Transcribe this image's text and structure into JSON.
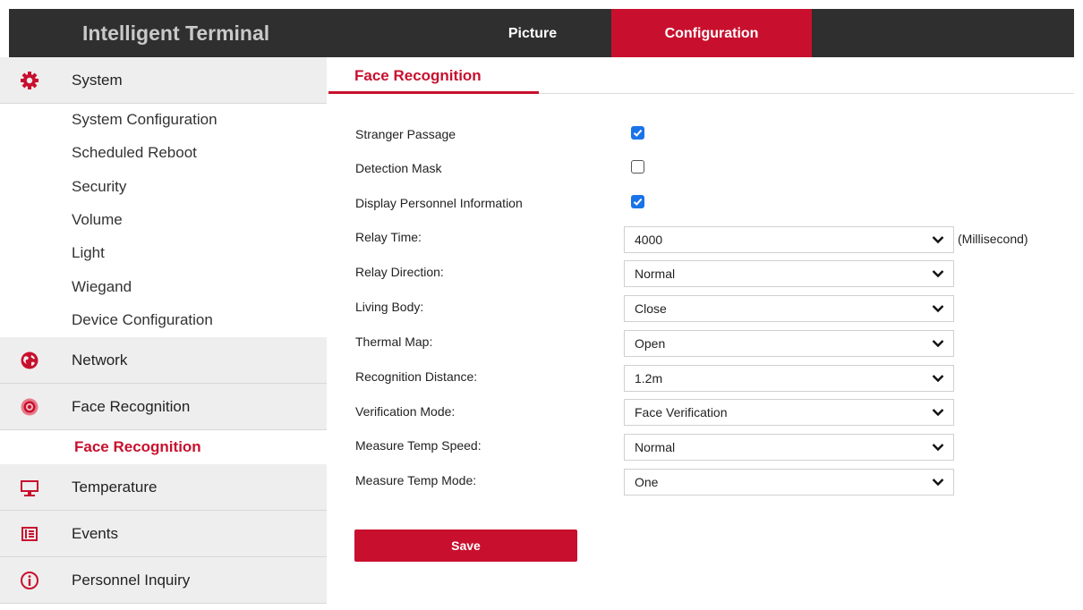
{
  "header": {
    "brand": "Intelligent Terminal",
    "tabs": [
      {
        "label": "Picture"
      },
      {
        "label": "Configuration"
      }
    ]
  },
  "sidebar": {
    "system": {
      "label": "System",
      "icon": "gear-icon",
      "items": [
        "System Configuration",
        "Scheduled Reboot",
        "Security",
        "Volume",
        "Light",
        "Wiegand",
        "Device Configuration"
      ]
    },
    "network": {
      "label": "Network",
      "icon": "globe-icon"
    },
    "face_recognition": {
      "label": "Face Recognition",
      "icon": "target-icon",
      "items": [
        "Face Recognition"
      ]
    },
    "temperature": {
      "label": "Temperature",
      "icon": "monitor-icon"
    },
    "events": {
      "label": "Events",
      "icon": "list-icon"
    },
    "personnel_inquiry": {
      "label": "Personnel Inquiry",
      "icon": "info-icon"
    }
  },
  "main": {
    "tab": "Face Recognition",
    "checkboxes": [
      {
        "label": "Stranger Passage",
        "checked": true
      },
      {
        "label": "Detection Mask",
        "checked": false
      },
      {
        "label": "Display Personnel Information",
        "checked": true
      }
    ],
    "selects": [
      {
        "label": "Relay Time:",
        "value": "4000"
      },
      {
        "label": "Relay Direction:",
        "value": "Normal"
      },
      {
        "label": "Living Body:",
        "value": "Close"
      },
      {
        "label": "Thermal Map:",
        "value": "Open"
      },
      {
        "label": "Recognition Distance:",
        "value": "1.2m"
      },
      {
        "label": "Verification Mode:",
        "value": "Face Verification"
      },
      {
        "label": "Measure Temp Speed:",
        "value": "Normal"
      },
      {
        "label": "Measure Temp Mode:",
        "value": "One"
      }
    ],
    "relay_time_unit": "(Millisecond)",
    "save_label": "Save"
  },
  "colors": {
    "accent": "#c8102e",
    "header_bg": "#2f2f2f",
    "checkbox": "#1a73e8"
  }
}
